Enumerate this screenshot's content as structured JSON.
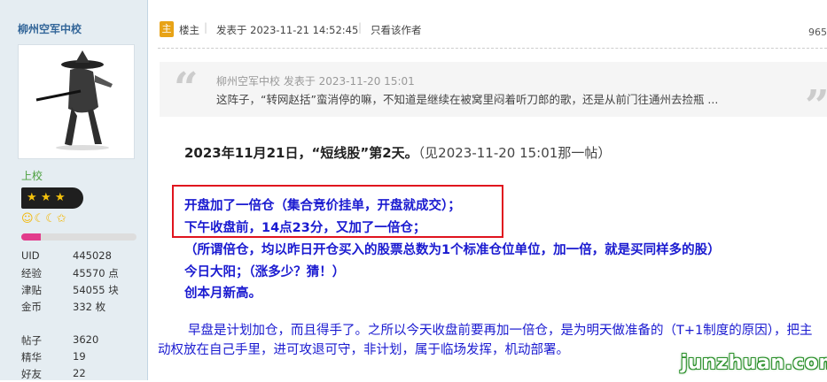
{
  "sidebar": {
    "username": "柳州空军中校",
    "rank": "上校",
    "level_icons": "☺☾☾✩",
    "progress_fraction": 0.17,
    "stats": [
      {
        "label": "UID",
        "value": "445028"
      },
      {
        "label": "经验",
        "value": "45570 点"
      },
      {
        "label": "津贴",
        "value": "54055 块"
      },
      {
        "label": "金币",
        "value": "332 枚"
      },
      {
        "label": "",
        "value": ""
      },
      {
        "label": "帖子",
        "value": "3620"
      },
      {
        "label": "精华",
        "value": "19"
      },
      {
        "label": "好友",
        "value": "22"
      }
    ]
  },
  "post_header": {
    "op_label": "楼主",
    "posted_at": "发表于 2023-11-21 14:52:45",
    "only_author": "只看该作者",
    "views": "965"
  },
  "quote": {
    "meta": "柳州空军中校 发表于 2023-11-20 15:01",
    "text": "这阵子，“转网赵括”蛮消停的嘛，不知道是继续在被窝里闷着听刀郎的歌，还是从前门往通州去捡瓶 ..."
  },
  "content": {
    "headline_bold": "2023年11月21日，“短线股”第2天。",
    "headline_ref": "（见2023-11-20 15:01那一帖）",
    "lines": [
      "开盘加了一倍仓（集合竞价挂单，开盘就成交）；",
      "下午收盘前，14点23分，又加了一倍仓；",
      "（所谓倍仓，均以昨日开仓买入的股票总数为1个标准仓位单位，加一倍，就是买同样多的股）",
      "今日大阳；（涨多少？猜！）",
      "创本月新高。"
    ],
    "paragraph": "早盘是计划加仓，而且得手了。之所以今天收盘前要再加一倍仓，是为明天做准备的（T+1制度的原因），把主动权放在自己手里，进可攻退可守，非计划，属于临场发挥，机动部署。"
  },
  "watermark": "junzhuan.com",
  "colors": {
    "highlight_box": "#e0141e",
    "content_blue": "#1a1ad0",
    "username_blue": "#336699",
    "rank_green": "#4a9f3c"
  }
}
